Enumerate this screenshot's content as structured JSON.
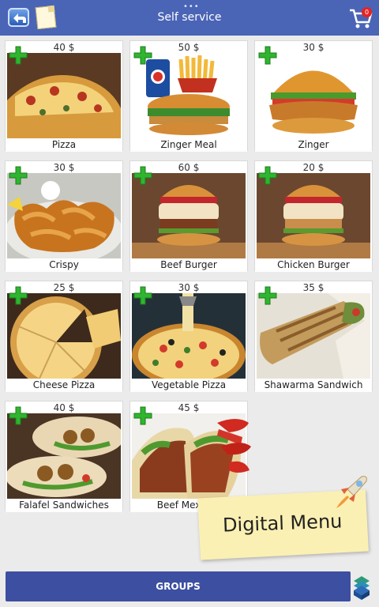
{
  "header": {
    "title": "Self service",
    "cart_count": "0"
  },
  "products": [
    {
      "name": "Pizza",
      "price": "40 $"
    },
    {
      "name": "Zinger Meal",
      "price": "50 $"
    },
    {
      "name": "Zinger",
      "price": "30 $"
    },
    {
      "name": "Crispy",
      "price": "30 $"
    },
    {
      "name": "Beef Burger",
      "price": "60 $"
    },
    {
      "name": "Chicken Burger",
      "price": "20 $"
    },
    {
      "name": "Cheese Pizza",
      "price": "25 $"
    },
    {
      "name": "Vegetable Pizza",
      "price": "30 $"
    },
    {
      "name": "Shawarma Sandwich",
      "price": "35 $"
    },
    {
      "name": "Falafel Sandwiches",
      "price": "40 $"
    },
    {
      "name": "Beef Mexican",
      "price": "45 $"
    }
  ],
  "footer": {
    "groups_label": "GROUPS"
  },
  "overlay": {
    "sticky_label": "Digital Menu"
  },
  "colors": {
    "topbar": "#4a64b6",
    "groups_bar": "#3d4fa0",
    "add_icon": "#2fb52f"
  }
}
